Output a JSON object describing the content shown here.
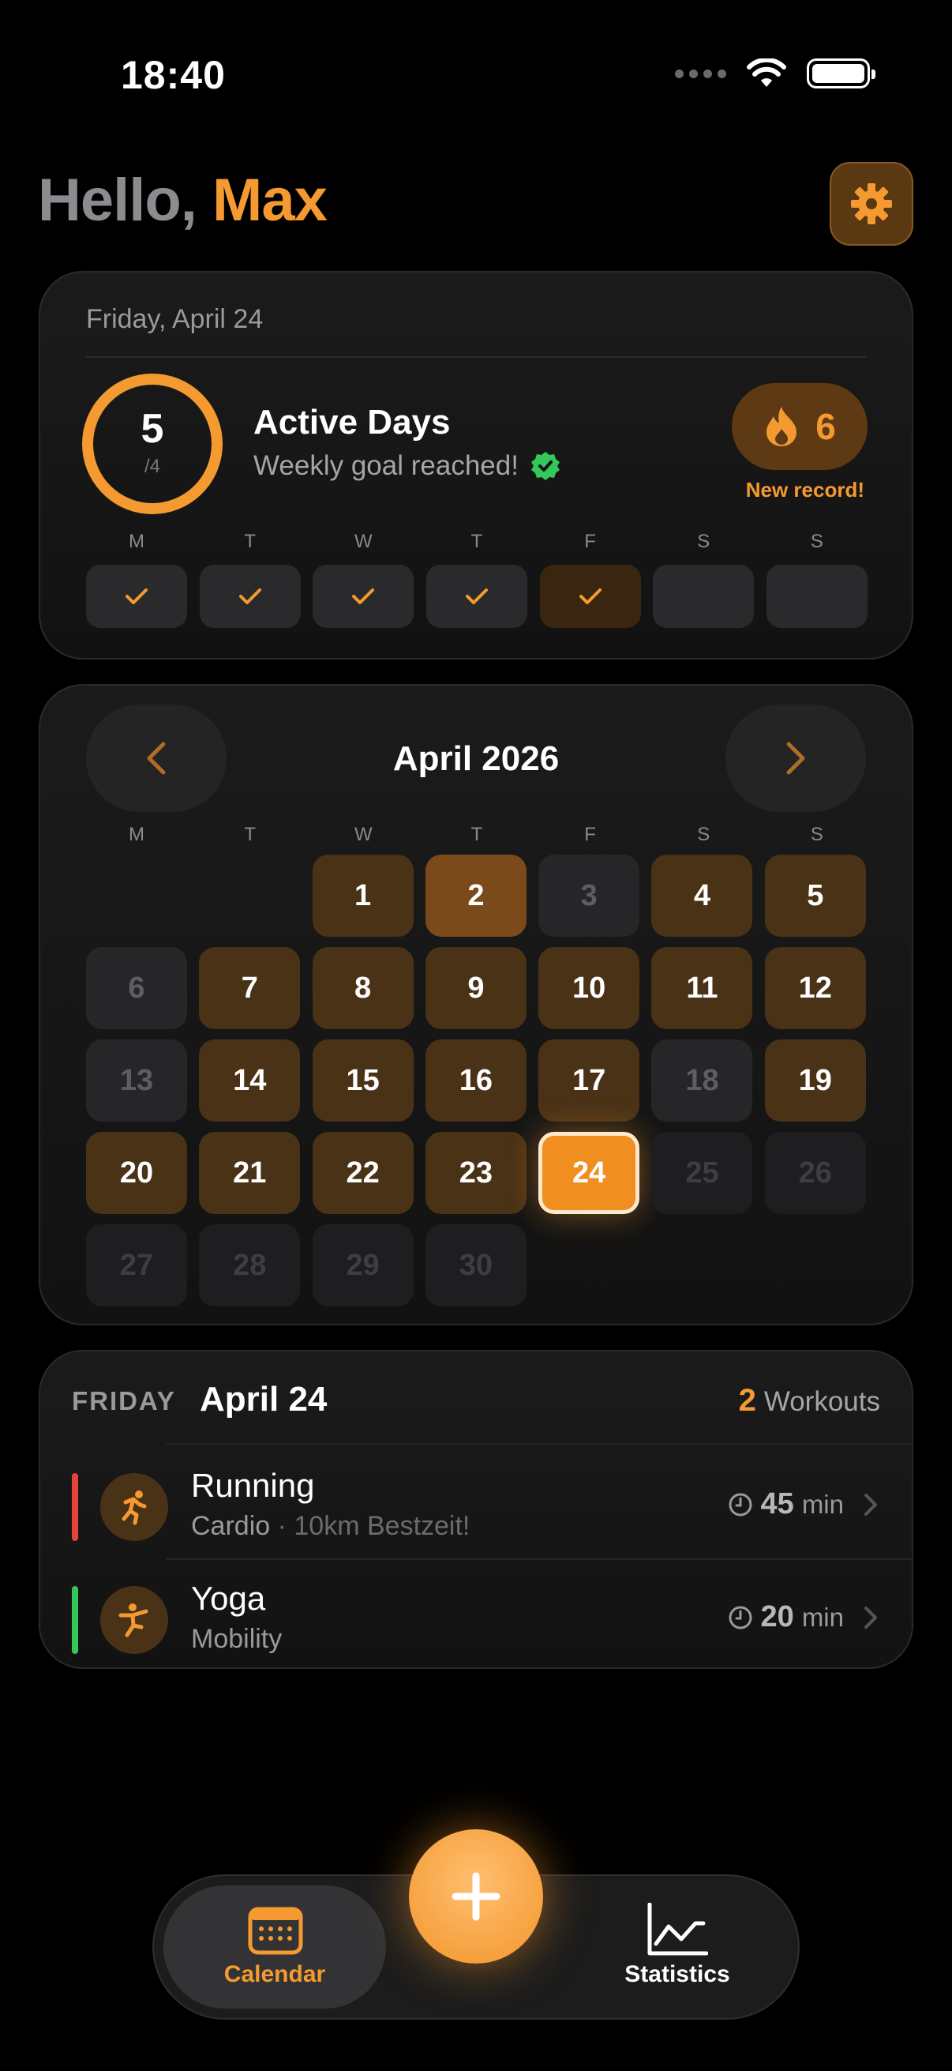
{
  "status_bar": {
    "time": "18:40"
  },
  "header": {
    "greeting_prefix": "Hello,",
    "user_name": "Max"
  },
  "activity": {
    "date": "Friday, April 24",
    "active_days": "5",
    "goal": "/4",
    "goal_progress": 1.0,
    "title": "Active Days",
    "subtitle": "Weekly goal reached!",
    "streak": "6",
    "streak_note": "New record!",
    "week_days": [
      "M",
      "T",
      "W",
      "T",
      "F",
      "S",
      "S"
    ],
    "week_done": [
      true,
      true,
      true,
      true,
      true,
      false,
      false
    ]
  },
  "calendar": {
    "title": "April 2026",
    "weekdays": [
      "M",
      "T",
      "W",
      "T",
      "F",
      "S",
      "S"
    ],
    "leading_blanks": 2,
    "days": [
      {
        "d": "1",
        "s": "active"
      },
      {
        "d": "2",
        "s": "hi"
      },
      {
        "d": "3",
        "s": "rest"
      },
      {
        "d": "4",
        "s": "active"
      },
      {
        "d": "5",
        "s": "active"
      },
      {
        "d": "6",
        "s": "rest"
      },
      {
        "d": "7",
        "s": "active"
      },
      {
        "d": "8",
        "s": "active"
      },
      {
        "d": "9",
        "s": "active"
      },
      {
        "d": "10",
        "s": "active"
      },
      {
        "d": "11",
        "s": "active"
      },
      {
        "d": "12",
        "s": "active"
      },
      {
        "d": "13",
        "s": "rest"
      },
      {
        "d": "14",
        "s": "active"
      },
      {
        "d": "15",
        "s": "active"
      },
      {
        "d": "16",
        "s": "active"
      },
      {
        "d": "17",
        "s": "active"
      },
      {
        "d": "18",
        "s": "rest"
      },
      {
        "d": "19",
        "s": "active"
      },
      {
        "d": "20",
        "s": "active"
      },
      {
        "d": "21",
        "s": "active"
      },
      {
        "d": "22",
        "s": "active"
      },
      {
        "d": "23",
        "s": "active"
      },
      {
        "d": "24",
        "s": "today"
      },
      {
        "d": "25",
        "s": "future"
      },
      {
        "d": "26",
        "s": "future"
      },
      {
        "d": "27",
        "s": "future"
      },
      {
        "d": "28",
        "s": "future"
      },
      {
        "d": "29",
        "s": "future"
      },
      {
        "d": "30",
        "s": "future"
      }
    ]
  },
  "workouts": {
    "day_label": "FRIDAY",
    "date": "April 24",
    "count": "2",
    "count_label": "Workouts",
    "items": [
      {
        "name": "Running",
        "category": "Cardio",
        "note": "· 10km Bestzeit!",
        "duration": "45",
        "unit": "min",
        "color": "#e8423f",
        "icon": "running-icon"
      },
      {
        "name": "Yoga",
        "category": "Mobility",
        "note": "",
        "duration": "20",
        "unit": "min",
        "color": "#34c759",
        "icon": "yoga-icon"
      }
    ]
  },
  "tabbar": {
    "calendar_label": "Calendar",
    "statistics_label": "Statistics"
  },
  "colors": {
    "accent": "#f59a30",
    "background": "#000000",
    "card": "#161616",
    "success": "#34c759"
  }
}
